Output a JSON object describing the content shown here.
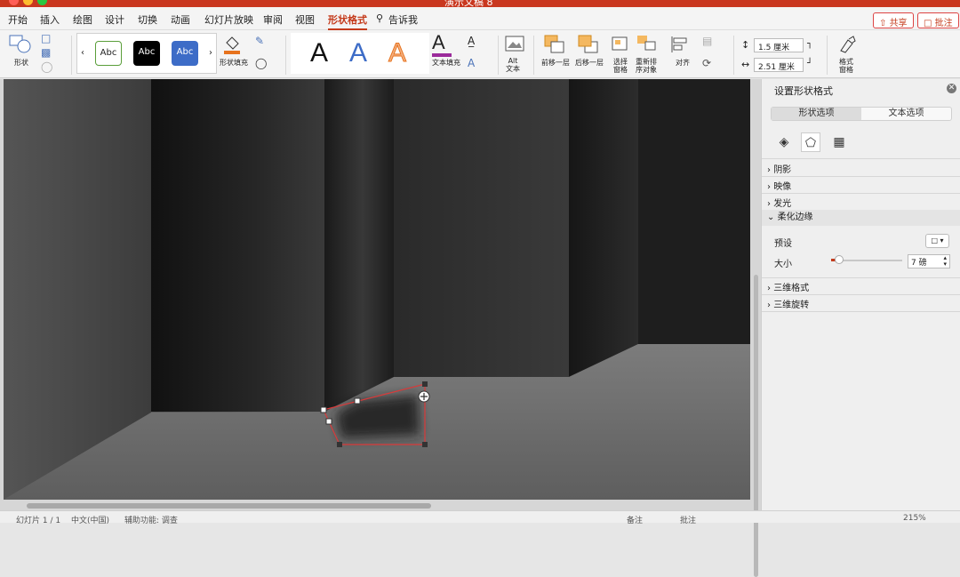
{
  "window": {
    "title": "演示文稿 8"
  },
  "menu": {
    "items": [
      "开始",
      "插入",
      "绘图",
      "设计",
      "切换",
      "动画",
      "幻灯片放映",
      "审阅",
      "视图",
      "形状格式"
    ],
    "tell_me": "告诉我",
    "share": "共享",
    "comment": "批注"
  },
  "ribbon": {
    "shape_label": "形状",
    "style_samples": [
      "Abc",
      "Abc",
      "Abc"
    ],
    "shape_fill": "形状填充",
    "wordart_letters": [
      "A",
      "A",
      "A"
    ],
    "text_fill": "文本填充",
    "alt_text": "Alt\n文本",
    "bring_forward": "前移一层",
    "send_backward": "后移一层",
    "selection_pane": "选择\n窗格",
    "reorder": "重新排\n序对象",
    "align": "对齐",
    "height_value": "1.5 厘米",
    "width_value": "2.51 厘米",
    "format_pane": "格式\n窗格"
  },
  "pane": {
    "title": "设置形状格式",
    "tabs": [
      "形状选项",
      "文本选项"
    ],
    "sections": [
      "阴影",
      "映像",
      "发光",
      "柔化边缘",
      "三维格式",
      "三维旋转"
    ],
    "preset_label": "预设",
    "size_label": "大小",
    "size_value": "7 磅",
    "soften_fraction": 0.07
  },
  "status": {
    "slide": "幻灯片 1 / 1",
    "lang": "中文(中国)",
    "accessibility": "辅助功能: 调查",
    "notes": "备注",
    "comments": "批注",
    "zoom": "215%"
  },
  "colors": {
    "accent": "#c43b1c",
    "selection": "#d93a3a"
  }
}
